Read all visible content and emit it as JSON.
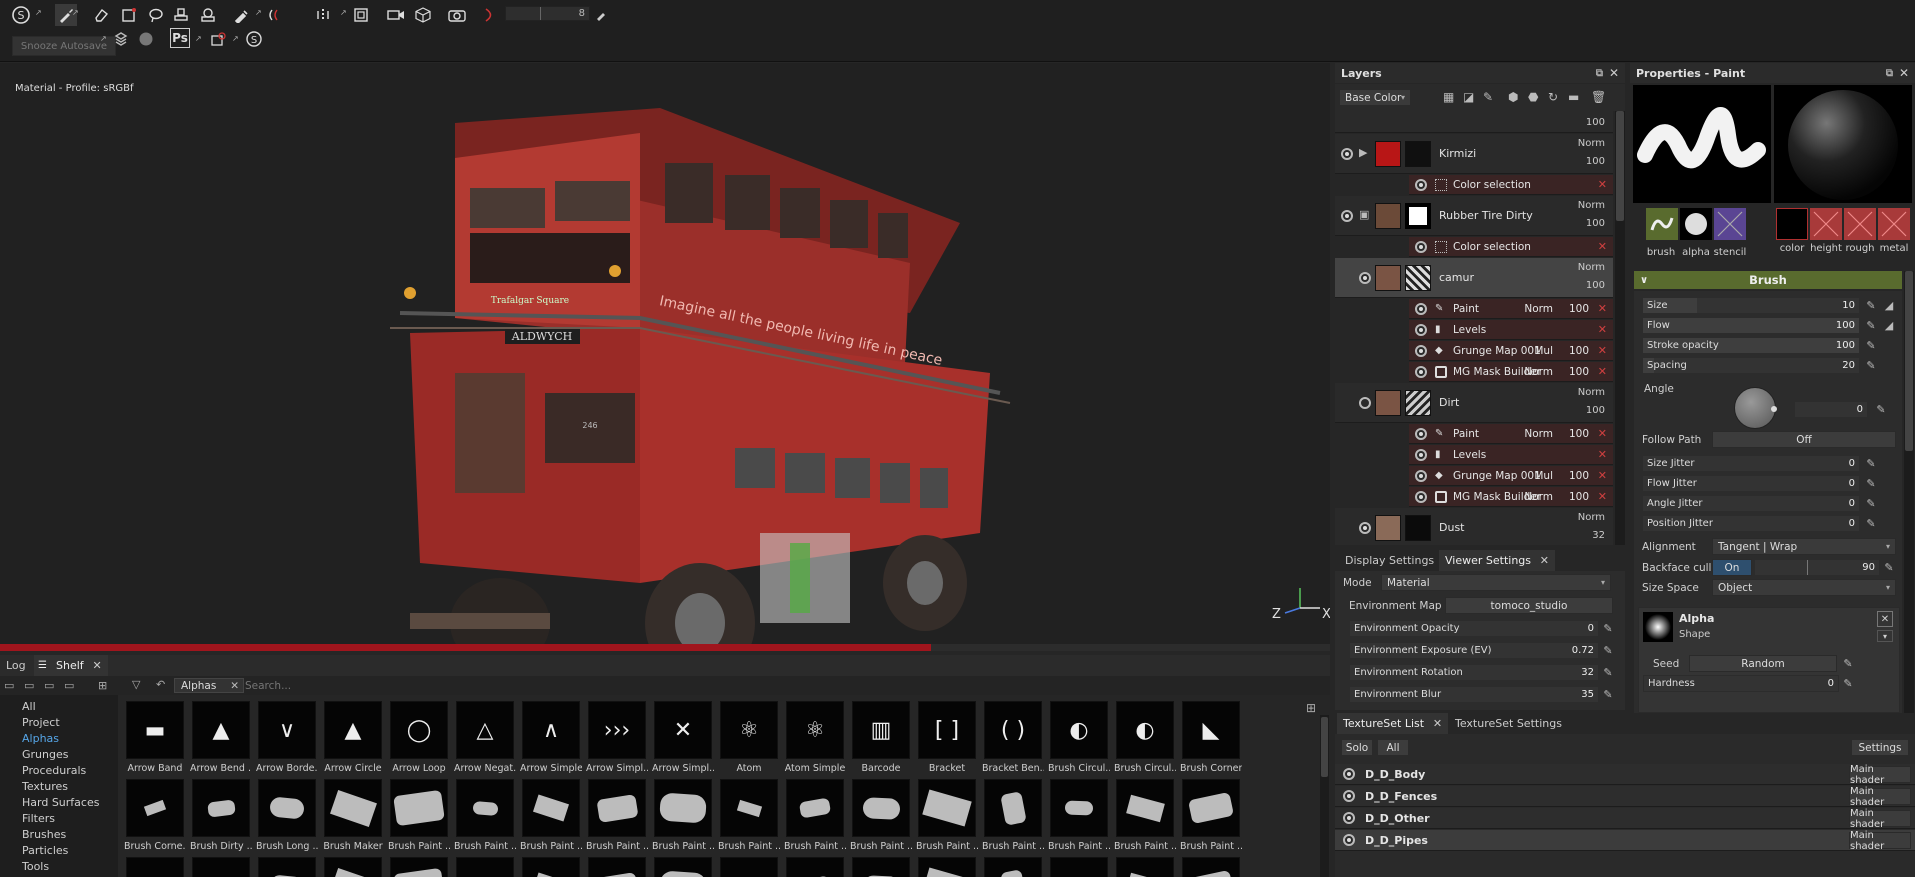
{
  "toolbar": {
    "brush_size_value": "8",
    "snooze_autosave": "Snooze Autosave",
    "ps_label": "Ps"
  },
  "viewport": {
    "label": "Material - Profile: sRGBf",
    "progress": 0.7,
    "axis_z": "Z",
    "axis_x": "X",
    "bus_text": {
      "destination": "ALDWYCH",
      "square": "Trafalgar Square",
      "banner": "Imagine all the people living life in peace",
      "number": "246"
    }
  },
  "layers": {
    "title": "Layers",
    "channel": "Base Color",
    "rows": [
      {
        "name": "Kirmizi",
        "blend": "Norm",
        "opacity": "100"
      },
      {
        "name": "Rubber Tire Dirty",
        "blend": "Norm",
        "opacity": "100"
      },
      {
        "name": "camur",
        "blend": "Norm",
        "opacity": "100"
      },
      {
        "name": "Dirt",
        "blend": "Norm",
        "opacity": "100"
      },
      {
        "name": "Dust",
        "blend": "Norm",
        "opacity": "32"
      }
    ],
    "top_opacity": "100",
    "color_selection": "Color selection",
    "effects": [
      {
        "name": "Paint",
        "blend": "Norm",
        "opacity": "100"
      },
      {
        "name": "Levels",
        "blend": "",
        "opacity": ""
      },
      {
        "name": "Grunge Map 001",
        "blend": "Mul",
        "opacity": "100"
      },
      {
        "name": "MG Mask Builder",
        "blend": "Norm",
        "opacity": "100"
      }
    ]
  },
  "viewer": {
    "tabs": [
      "Display Settings",
      "Viewer Settings"
    ],
    "mode_label": "Mode",
    "mode_value": "Material",
    "env_map_label": "Environment Map",
    "env_map_value": "tomoco_studio",
    "rows": [
      {
        "label": "Environment Opacity",
        "value": "0"
      },
      {
        "label": "Environment Exposure (EV)",
        "value": "0.72"
      },
      {
        "label": "Environment Rotation",
        "value": "32"
      },
      {
        "label": "Environment Blur",
        "value": "35"
      }
    ]
  },
  "properties": {
    "title": "Properties - Paint",
    "channels_left": [
      "brush",
      "alpha",
      "stencil"
    ],
    "channels_right": [
      "color",
      "height",
      "rough",
      "metal"
    ],
    "brush_header": "Brush",
    "sliders": [
      {
        "label": "Size",
        "value": "10",
        "fill": 0.25
      },
      {
        "label": "Flow",
        "value": "100",
        "fill": 1.0
      },
      {
        "label": "Stroke opacity",
        "value": "100",
        "fill": 1.0
      },
      {
        "label": "Spacing",
        "value": "20",
        "fill": 0.05
      }
    ],
    "angle_label": "Angle",
    "angle_value": "0",
    "follow_path_label": "Follow Path",
    "follow_path_value": "Off",
    "jitters": [
      {
        "label": "Size Jitter",
        "value": "0"
      },
      {
        "label": "Flow Jitter",
        "value": "0"
      },
      {
        "label": "Angle Jitter",
        "value": "0"
      },
      {
        "label": "Position Jitter",
        "value": "0"
      }
    ],
    "alignment_label": "Alignment",
    "alignment_value": "Tangent | Wrap",
    "backface_label": "Backface culling",
    "backface_value": "On",
    "backface_angle": "90",
    "size_space_label": "Size Space",
    "size_space_value": "Object",
    "alpha_title": "Alpha",
    "alpha_sub": "Shape",
    "seed_label": "Seed",
    "seed_value": "Random",
    "hardness_label": "Hardness",
    "hardness_value": "0"
  },
  "shelf": {
    "tabs": [
      "Log",
      "Shelf"
    ],
    "filter_tag": "Alphas",
    "search_placeholder": "Search...",
    "categories": [
      "All",
      "Project",
      "Alphas",
      "Grunges",
      "Procedurals",
      "Textures",
      "Hard Surfaces",
      "Filters",
      "Brushes",
      "Particles",
      "Tools"
    ],
    "active_category": "Alphas",
    "row1": [
      "Arrow Band",
      "Arrow Bend ...",
      "Arrow Borde...",
      "Arrow Circle",
      "Arrow Loop",
      "Arrow Negat...",
      "Arrow Simple",
      "Arrow Simpl...",
      "Arrow Simpl...",
      "Atom",
      "Atom Simple",
      "Barcode",
      "Bracket",
      "Bracket Ben...",
      "Brush Circul...",
      "Brush Circul...",
      "Brush Corner"
    ],
    "row2": [
      "Brush Corne...",
      "Brush Dirty ...",
      "Brush Long ...",
      "Brush Maker",
      "Brush Paint ...",
      "Brush Paint ...",
      "Brush Paint ...",
      "Brush Paint ...",
      "Brush Paint ...",
      "Brush Paint ...",
      "Brush Paint ...",
      "Brush Paint ...",
      "Brush Paint ...",
      "Brush Paint ...",
      "Brush Paint ...",
      "Brush Paint ...",
      "Brush Paint ..."
    ]
  },
  "textureset": {
    "tabs": [
      "TextureSet List",
      "TextureSet Settings"
    ],
    "solo": "Solo",
    "all": "All",
    "settings": "Settings",
    "rows": [
      {
        "name": "D_D_Body",
        "shader": "Main shader"
      },
      {
        "name": "D_D_Fences",
        "shader": "Main shader"
      },
      {
        "name": "D_D_Other",
        "shader": "Main shader"
      },
      {
        "name": "D_D_Pipes",
        "shader": "Main shader"
      }
    ]
  },
  "colors": {
    "accent_blue": "#56a6e8",
    "progress_red": "#a0151d",
    "brush_header": "#596b2e",
    "stencil": "#5a4593"
  }
}
